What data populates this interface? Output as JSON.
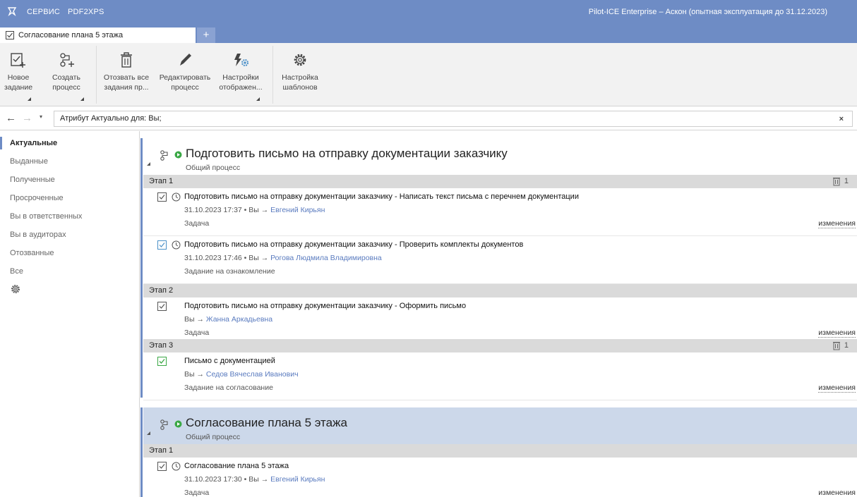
{
  "titlebar": {
    "menu": [
      "СЕРВИС",
      "PDF2XPS"
    ],
    "title": "Pilot-ICE Enterprise – Аскон (опытная эксплуатация до 31.12.2023)"
  },
  "tab": {
    "label": "Согласование плана 5 этажа",
    "add": "+"
  },
  "ribbon": {
    "buttons": [
      {
        "label": "Новое\nзадание",
        "icon": "new-task-icon"
      },
      {
        "label": "Создать\nпроцесс",
        "icon": "create-process-icon"
      },
      {
        "label": "Отозвать все\nзадания пр...",
        "icon": "trash-icon"
      },
      {
        "label": "Редактировать\nпроцесс",
        "icon": "pencil-icon"
      },
      {
        "label": "Настройки\nотображен...",
        "icon": "display-settings-icon"
      },
      {
        "label": "Настройка\nшаблонов",
        "icon": "gear-icon"
      }
    ]
  },
  "filter": {
    "back": "←",
    "forward": "→",
    "dropdown": "▾",
    "text": "Атрибут Актуально для: Вы;",
    "clear": "×"
  },
  "sidebar": {
    "items": [
      {
        "label": "Актуальные"
      },
      {
        "label": "Выданные"
      },
      {
        "label": "Полученные"
      },
      {
        "label": "Просроченные"
      },
      {
        "label": "Вы в ответственных"
      },
      {
        "label": "Вы в аудиторах"
      },
      {
        "label": "Отозванные"
      },
      {
        "label": "Все"
      }
    ]
  },
  "processes": [
    {
      "title": "Подготовить письмо на отправку документации заказчику",
      "subtitle": "Общий процесс",
      "stages": [
        {
          "label": "Этап 1",
          "count": "1",
          "tasks": [
            {
              "title": "Подготовить письмо на отправку документации заказчику - Написать текст письма с перечнем документации",
              "meta": "31.10.2023 17:37 • Вы → ",
              "assignee": "Евгений Кирьян",
              "type": "Задача",
              "changes": "изменения"
            },
            {
              "title": "Подготовить письмо на отправку документации заказчику - Проверить комплекты документов",
              "meta": "31.10.2023 17:46 • Вы → ",
              "assignee": "Рогова Людмила Владимировна",
              "type": "Задание на ознакомление",
              "changes": ""
            }
          ]
        },
        {
          "label": "Этап 2",
          "count": "",
          "tasks": [
            {
              "title": "Подготовить письмо на отправку документации заказчику - Оформить письмо",
              "meta": "Вы → ",
              "assignee": "Жанна Аркадьевна",
              "type": "Задача",
              "changes": "изменения"
            }
          ]
        },
        {
          "label": "Этап 3",
          "count": "1",
          "tasks": [
            {
              "title": "Письмо с документацией",
              "meta": "Вы → ",
              "assignee": "Седов Вячеслав Иванович",
              "type": "Задание на согласование",
              "changes": "изменения"
            }
          ]
        }
      ]
    },
    {
      "title": "Согласование плана 5 этажа",
      "subtitle": "Общий процесс",
      "stages": [
        {
          "label": "Этап 1",
          "count": "",
          "tasks": [
            {
              "title": "Согласование плана 5 этажа",
              "meta": "31.10.2023 17:30 • Вы → ",
              "assignee": "Евгений Кирьян",
              "type": "Задача",
              "changes": "изменения"
            }
          ]
        }
      ]
    }
  ],
  "colors": {
    "accent": "#6e8cc5",
    "link": "#5a7bbf",
    "check_green": "#3aa845",
    "play_green": "#3aa845"
  }
}
